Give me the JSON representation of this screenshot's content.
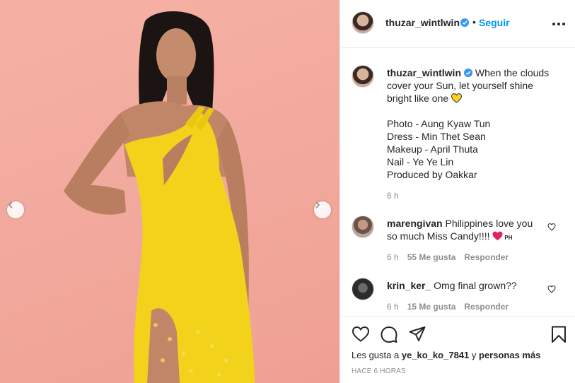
{
  "post": {
    "username": "thuzar_wintlwin",
    "follow_label": "Seguir",
    "separator": "•"
  },
  "caption": {
    "username": "thuzar_wintlwin",
    "lines": [
      "When the clouds",
      "cover your Sun, let yourself shine",
      "bright like one"
    ],
    "credits": [
      "Photo - Aung Kyaw Tun",
      "Dress - Min Thet Sean",
      "Makeup - April Thuta",
      "Nail - Ye Ye Lin",
      "Produced by Oakkar"
    ],
    "time": "6 h"
  },
  "comments": [
    {
      "username": "marengivan",
      "text_line1": "Philippines love you",
      "text_line2": "so much Miss Candy!!!!",
      "flag": "PH",
      "time": "6 h",
      "likes": "55 Me gusta",
      "reply": "Responder"
    },
    {
      "username": "krin_ker_",
      "text_line1": "Omg final grown??",
      "time": "6 h",
      "likes": "15 Me gusta",
      "reply": "Responder"
    }
  ],
  "likes": {
    "prefix": "Les gusta a",
    "user": "ye_ko_ko_7841",
    "middle": "y",
    "suffix": "personas más"
  },
  "timestamp": "HACE 6 HORAS",
  "icons": {
    "prev": "chevron-left-icon",
    "next": "chevron-right-icon",
    "like": "heart-icon",
    "comment": "comment-icon",
    "share": "share-icon",
    "save": "bookmark-icon",
    "verified": "verified-badge-icon",
    "more": "more-options-icon"
  },
  "colors": {
    "accent": "#0095f6",
    "background_photo": "#f3aa9e",
    "dress": "#f2d21b",
    "muted_text": "#8e8e8e"
  }
}
